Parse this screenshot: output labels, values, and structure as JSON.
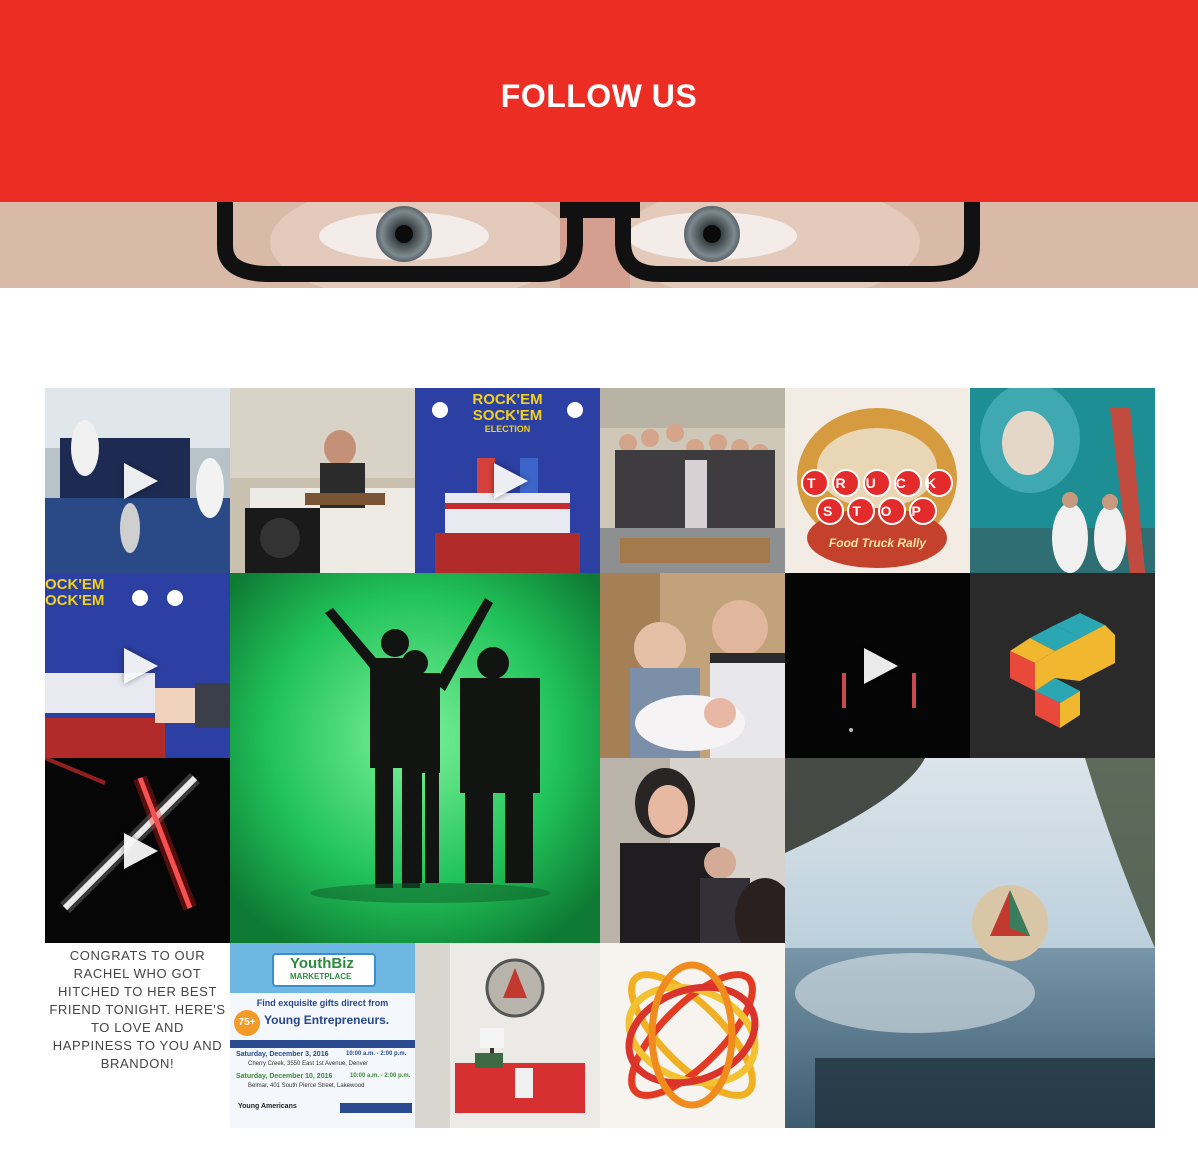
{
  "header": {
    "title": "FOLLOW US"
  },
  "feed": {
    "caption_post": "CONGRATS TO OUR RACHEL WHO GOT HITCHED TO HER BEST FRIEND TONIGHT. HERE'S TO LOVE AND HAPPINESS TO YOU AND BRANDON!",
    "rock_em_line1": "ROCK'EM",
    "rock_em_line2": "SOCK'EM",
    "rock_em_line3": "ELECTION",
    "rock_em_crop_line1": "OCK'EM",
    "rock_em_crop_line2": "OCK'EM",
    "truck_stop_line1": "TRUCK",
    "truck_stop_line2": "STOP",
    "truck_stop_sub": "Food Truck Rally",
    "youthbiz": {
      "title": "YouthBiz",
      "subtitle": "MARKETPLACE",
      "line1": "Find exquisite gifts direct from",
      "count": "75+",
      "line2": "Young Entrepreneurs.",
      "date1": "Saturday, December 3, 2016",
      "time1": "10:00 a.m. - 2:00 p.m.",
      "place1": "Cherry Creek, 3550 East 1st Avenue, Denver",
      "date2": "Saturday, December 10, 2016",
      "time2": "10:00 a.m. - 2:00 p.m.",
      "place2": "Belmar, 401 South Pierce Street, Lakewood",
      "org": "Young Americans"
    }
  },
  "colors": {
    "brand_red": "#ec2d24",
    "white": "#ffffff"
  }
}
